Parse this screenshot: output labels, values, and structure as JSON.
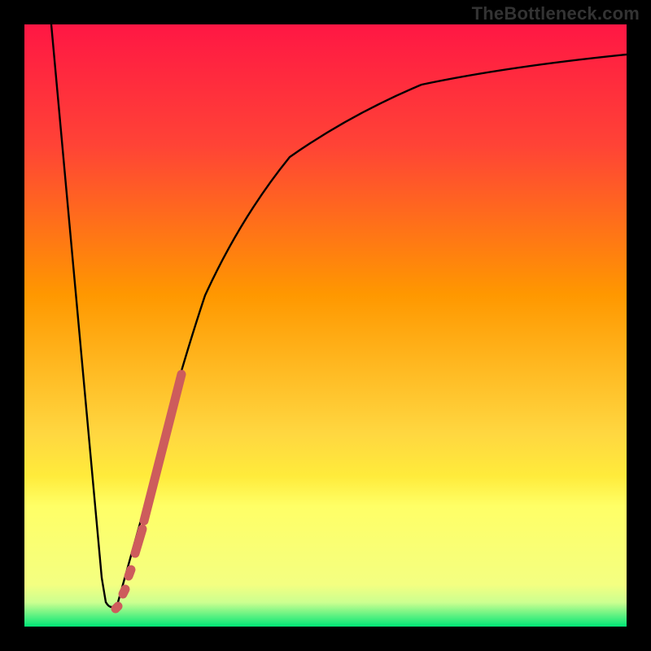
{
  "watermark": "TheBottleneck.com",
  "chart_data": {
    "type": "line",
    "title": "",
    "xlabel": "",
    "ylabel": "",
    "xlim": [
      0,
      100
    ],
    "ylim": [
      0,
      100
    ],
    "gradient_stops": [
      {
        "offset": 0,
        "color": "#ff1744"
      },
      {
        "offset": 20,
        "color": "#ff4336"
      },
      {
        "offset": 45,
        "color": "#ff9800"
      },
      {
        "offset": 68,
        "color": "#ffd740"
      },
      {
        "offset": 75,
        "color": "#ffeb3b"
      },
      {
        "offset": 80,
        "color": "#ffff66"
      },
      {
        "offset": 93,
        "color": "#f4ff81"
      },
      {
        "offset": 96,
        "color": "#ccff90"
      },
      {
        "offset": 100,
        "color": "#00e676"
      }
    ],
    "series": [
      {
        "name": "bottleneck-curve",
        "type": "line",
        "color": "#000000",
        "points": [
          {
            "x": 4.5,
            "y": 100
          },
          {
            "x": 12.8,
            "y": 8
          },
          {
            "x": 13.5,
            "y": 4
          },
          {
            "x": 14.5,
            "y": 2.5
          },
          {
            "x": 16.0,
            "y": 4
          },
          {
            "x": 20.0,
            "y": 20
          },
          {
            "x": 25.0,
            "y": 40
          },
          {
            "x": 30.0,
            "y": 55
          },
          {
            "x": 36.0,
            "y": 68
          },
          {
            "x": 44.0,
            "y": 78
          },
          {
            "x": 54.0,
            "y": 85
          },
          {
            "x": 66.0,
            "y": 90
          },
          {
            "x": 80.0,
            "y": 93
          },
          {
            "x": 100.0,
            "y": 95
          }
        ]
      },
      {
        "name": "data-markers",
        "type": "scatter",
        "color": "#cd5c5c",
        "points": [
          {
            "x": 15.5,
            "y": 3.5
          },
          {
            "x": 16.5,
            "y": 6
          },
          {
            "x": 17.5,
            "y": 10
          },
          {
            "x": 18.5,
            "y": 14
          },
          {
            "x": 19.8,
            "y": 19
          },
          {
            "x": 21.0,
            "y": 24
          },
          {
            "x": 22.2,
            "y": 29
          },
          {
            "x": 23.5,
            "y": 34
          },
          {
            "x": 24.8,
            "y": 39
          },
          {
            "x": 26.0,
            "y": 44
          }
        ]
      }
    ]
  }
}
